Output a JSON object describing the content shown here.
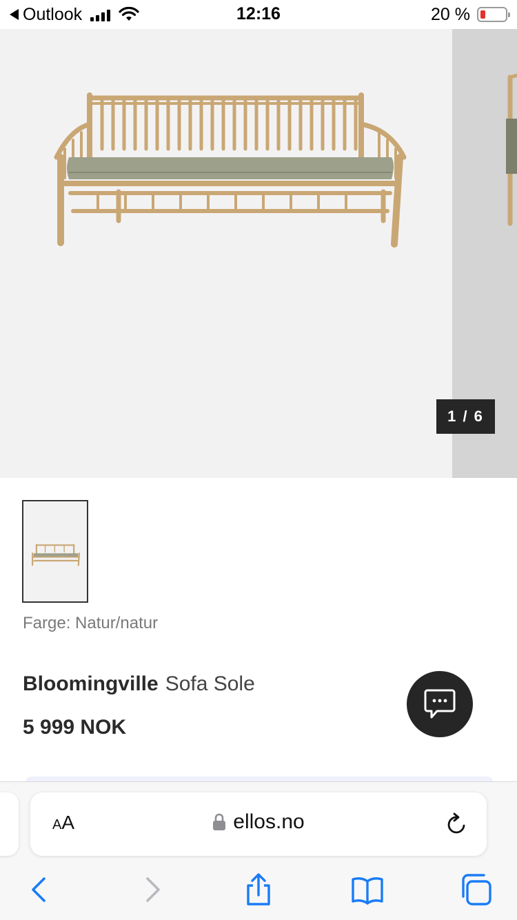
{
  "status_bar": {
    "back_app": "Outlook",
    "time": "12:16",
    "battery_percent": "20 %",
    "battery_level": 0.2
  },
  "gallery": {
    "counter": "1 / 6",
    "current_index": 1,
    "total_images": 6
  },
  "product": {
    "color_label": "Farge: Natur/natur",
    "brand": "Bloomingville",
    "name": "Sofa Sole",
    "price": "5 999 NOK"
  },
  "browser": {
    "text_size_label_small": "A",
    "text_size_label_big": "A",
    "url": "ellos.no"
  },
  "icons": {
    "back": "chevron-left-icon",
    "forward": "chevron-right-icon",
    "share": "share-icon",
    "bookmarks": "book-icon",
    "tabs": "tabs-icon",
    "chat": "chat-bubble-icon",
    "lock": "lock-icon",
    "reload": "reload-icon"
  },
  "colors": {
    "accent_blue": "#1a7cf5",
    "dark_badge": "#262626",
    "gallery_bg": "#f3f2f3"
  }
}
